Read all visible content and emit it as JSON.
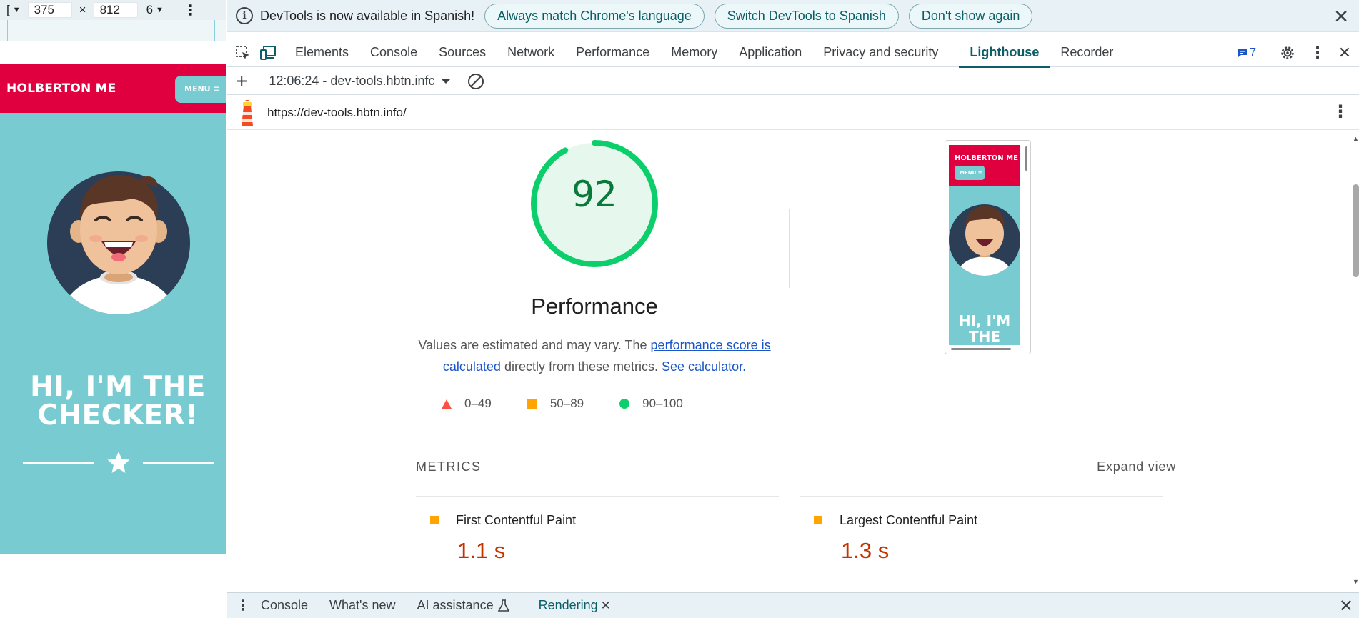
{
  "device_toolbar": {
    "dimension_dropdown_glyph": "[",
    "width": "375",
    "times": "×",
    "height": "812",
    "zoom_glyph": "6"
  },
  "site": {
    "logo": "HOLBERTON ME",
    "menu_label": "MENU ≡",
    "hero_line1": "HI, I'M THE",
    "hero_line2": "CHECKER!"
  },
  "infobar": {
    "message": "DevTools is now available in Spanish!",
    "buttons": [
      "Always match Chrome's language",
      "Switch DevTools to Spanish",
      "Don't show again"
    ]
  },
  "tabs": [
    {
      "label": "Elements",
      "active": false
    },
    {
      "label": "Console",
      "active": false
    },
    {
      "label": "Sources",
      "active": false
    },
    {
      "label": "Network",
      "active": false
    },
    {
      "label": "Performance",
      "active": false
    },
    {
      "label": "Memory",
      "active": false
    },
    {
      "label": "Application",
      "active": false
    },
    {
      "label": "Privacy and security",
      "active": false
    },
    {
      "label": "Lighthouse",
      "active": true
    },
    {
      "label": "Recorder",
      "active": false
    }
  ],
  "issues_count": "7",
  "lighthouse_toolbar": {
    "report_label": "12:06:24 - dev-tools.hbtn.infc"
  },
  "url": "https://dev-tools.hbtn.info/",
  "report": {
    "score": "92",
    "score_fraction": 0.92,
    "category": "Performance",
    "description_prefix": "Values are estimated and may vary. The ",
    "link_score": "performance score is calculated",
    "description_mid": " directly from these metrics. ",
    "link_calc": "See calculator.",
    "legend": [
      "0–49",
      "50–89",
      "90–100"
    ],
    "thumbnail": {
      "logo": "HOLBERTON ME",
      "menu": "MENU ≡",
      "hero_line1": "HI, I'M",
      "hero_line2": "THE"
    },
    "metrics_title": "METRICS",
    "expand_view": "Expand view",
    "metrics": [
      {
        "name": "First Contentful Paint",
        "value": "1.1 s"
      },
      {
        "name": "Largest Contentful Paint",
        "value": "1.3 s"
      }
    ]
  },
  "drawer": {
    "tabs": [
      {
        "label": "Console",
        "active": false
      },
      {
        "label": "What's new",
        "active": false
      },
      {
        "label": "AI assistance",
        "active": false
      },
      {
        "label": "Rendering",
        "active": true
      }
    ]
  },
  "colors": {
    "brand_red": "#e00040",
    "teal": "#79cbd2",
    "pass_green": "#0cce6b",
    "average_orange": "#ffa400",
    "fail_red": "#ff4e42",
    "active_tab": "#0b5e66"
  }
}
